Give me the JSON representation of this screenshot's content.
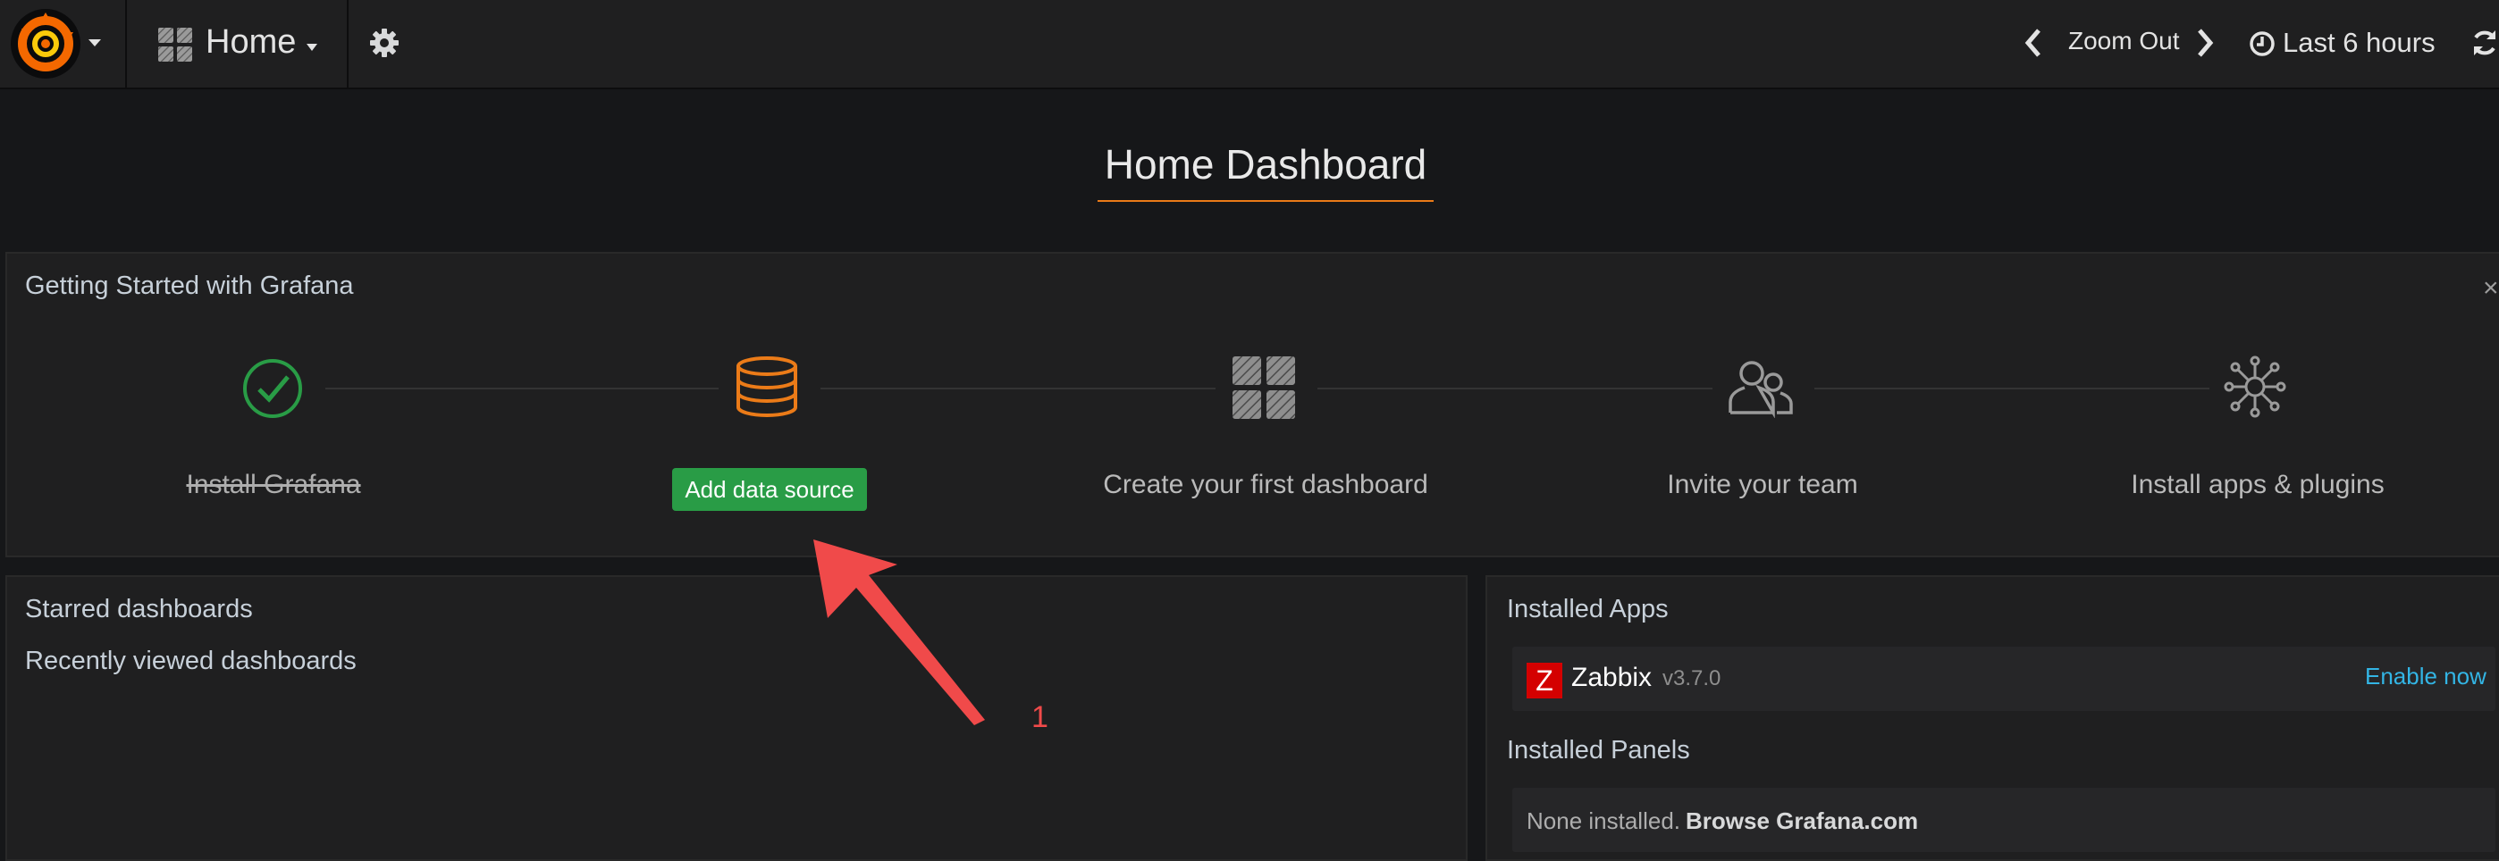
{
  "navbar": {
    "dashboard_name": "Home",
    "zoom_label": "Zoom Out",
    "time_range": "Last 6 hours"
  },
  "dashboard": {
    "title": "Home Dashboard"
  },
  "getting_started": {
    "title": "Getting Started with Grafana",
    "steps": [
      {
        "label": "Install Grafana",
        "status": "done",
        "icon": "check-circle-icon"
      },
      {
        "label": "Add data source",
        "status": "active",
        "icon": "database-icon"
      },
      {
        "label": "Create your first dashboard",
        "status": "todo",
        "icon": "dashboard-grid-icon"
      },
      {
        "label": "Invite your team",
        "status": "todo",
        "icon": "users-icon"
      },
      {
        "label": "Install apps & plugins",
        "status": "todo",
        "icon": "plugins-icon"
      }
    ]
  },
  "starred": {
    "title": "Starred dashboards",
    "recent_title": "Recently viewed dashboards"
  },
  "installed": {
    "apps_title": "Installed Apps",
    "apps": [
      {
        "name": "Zabbix",
        "version": "v3.7.0",
        "action": "Enable now",
        "logo_letter": "Z"
      }
    ],
    "panels_title": "Installed Panels",
    "panels_empty": "None installed.",
    "panels_browse": "Browse Grafana.com"
  },
  "annotation": {
    "number": "1",
    "color": "#f04a4a"
  },
  "colors": {
    "accent_orange": "#eb7b18",
    "success_green": "#299c46",
    "link_blue": "#33b5e5"
  }
}
